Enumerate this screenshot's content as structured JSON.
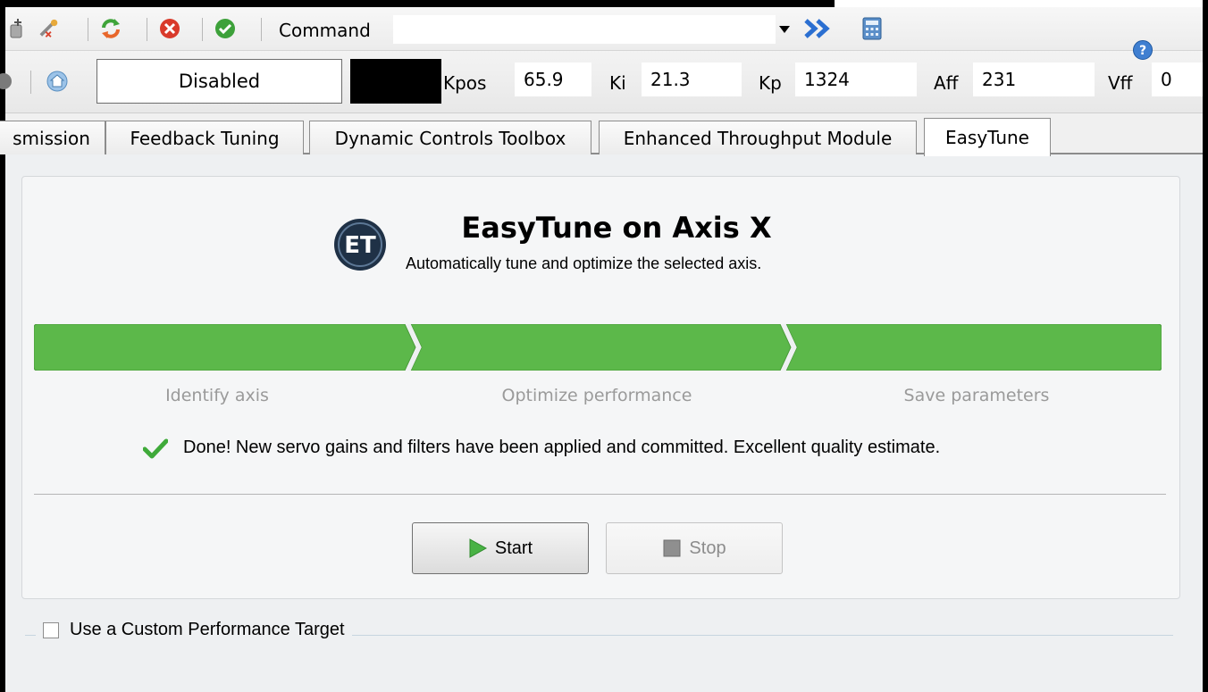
{
  "toolbar": {
    "command_label": "Command",
    "command_value": "",
    "icons": [
      "plugin-icon",
      "wizard-icon",
      "refresh-icon",
      "cancel-icon",
      "accept-icon",
      "dropdown-icon",
      "execute-icon",
      "calculator-icon"
    ]
  },
  "status_bar": {
    "status_text": "Disabled",
    "params": [
      {
        "label": "Kpos",
        "value": "65.9"
      },
      {
        "label": "Ki",
        "value": "21.3"
      },
      {
        "label": "Kp",
        "value": "1324"
      },
      {
        "label": "Aff",
        "value": "231"
      },
      {
        "label": "Vff",
        "value": "0"
      }
    ]
  },
  "tabs": [
    {
      "label": "smission"
    },
    {
      "label": "Feedback Tuning"
    },
    {
      "label": "Dynamic Controls Toolbox"
    },
    {
      "label": "Enhanced Throughput Module"
    },
    {
      "label": "EasyTune",
      "active": true
    }
  ],
  "easytune": {
    "logo_text": "ET",
    "title": "EasyTune on Axis X",
    "subtitle": "Automatically tune and optimize the selected axis.",
    "steps": [
      {
        "label": "Identify axis",
        "complete": true
      },
      {
        "label": "Optimize performance",
        "complete": true
      },
      {
        "label": "Save parameters",
        "complete": true
      }
    ],
    "progress_color": "#5cb84a",
    "status_message": "Done! New servo gains and filters have been applied and committed. Excellent quality estimate.",
    "start_label": "Start",
    "stop_label": "Stop",
    "custom_target_label": "Use a Custom Performance Target",
    "custom_target_checked": false
  }
}
